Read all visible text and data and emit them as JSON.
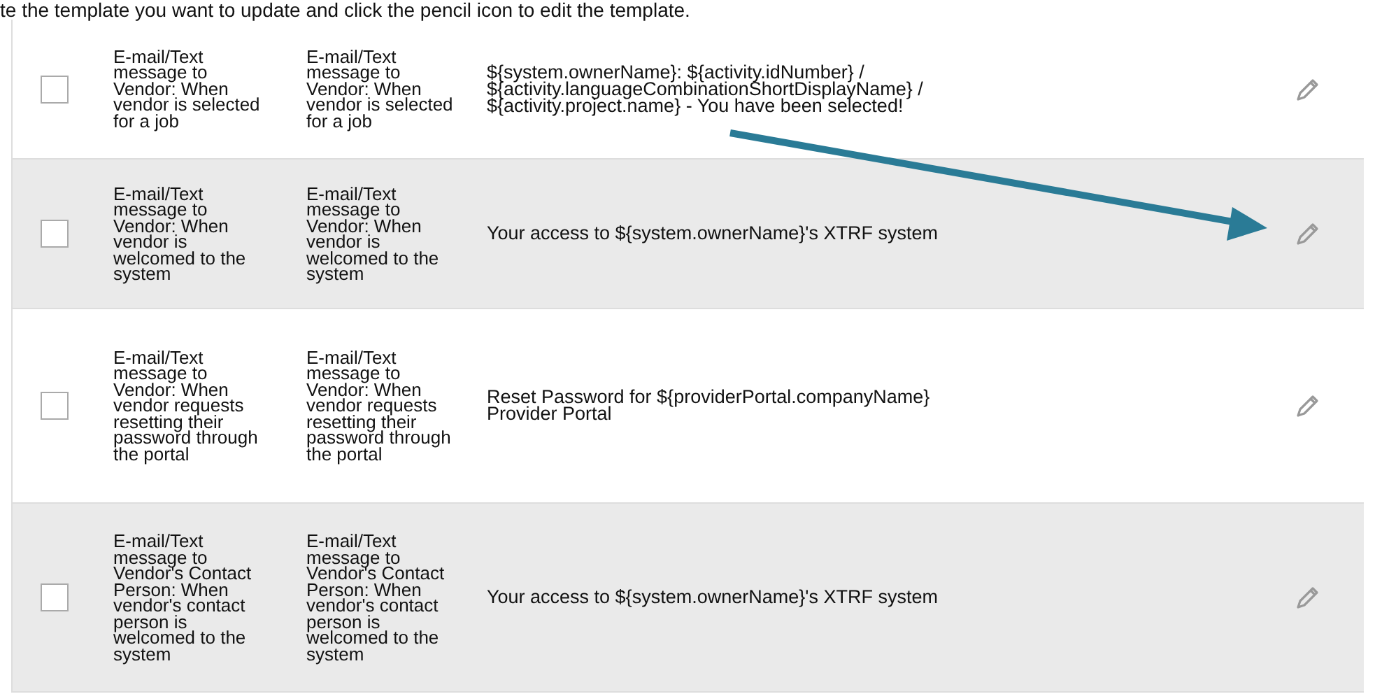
{
  "instruction": "te the template you want to update and click the pencil icon to edit the template.",
  "rows": [
    {
      "checked": false,
      "event": "E-mail/Text message to Vendor: When vendor is selected for a job",
      "name": "E-mail/Text message to Vendor: When vendor is selected for a job",
      "subject": "${system.ownerName}: ${activity.idNumber} / ${activity.languageCombinationShortDisplayName} / ${activity.project.name} - You have been selected!"
    },
    {
      "checked": false,
      "event": "E-mail/Text message to Vendor: When vendor is welcomed to the system",
      "name": "E-mail/Text message to Vendor: When vendor is welcomed to the system",
      "subject": "Your access to ${system.ownerName}'s XTRF system"
    },
    {
      "checked": false,
      "event": "E-mail/Text message to Vendor: When vendor requests resetting their password through the portal",
      "name": "E-mail/Text message to Vendor: When vendor requests resetting their password through the portal",
      "subject": "Reset Password for ${providerPortal.companyName} Provider Portal"
    },
    {
      "checked": false,
      "event": "E-mail/Text message to Vendor's Contact Person: When vendor's contact person is welcomed to the system",
      "name": "E-mail/Text message to Vendor's Contact Person: When vendor's contact person is welcomed to the system",
      "subject": "Your access to ${system.ownerName}'s XTRF system"
    }
  ]
}
